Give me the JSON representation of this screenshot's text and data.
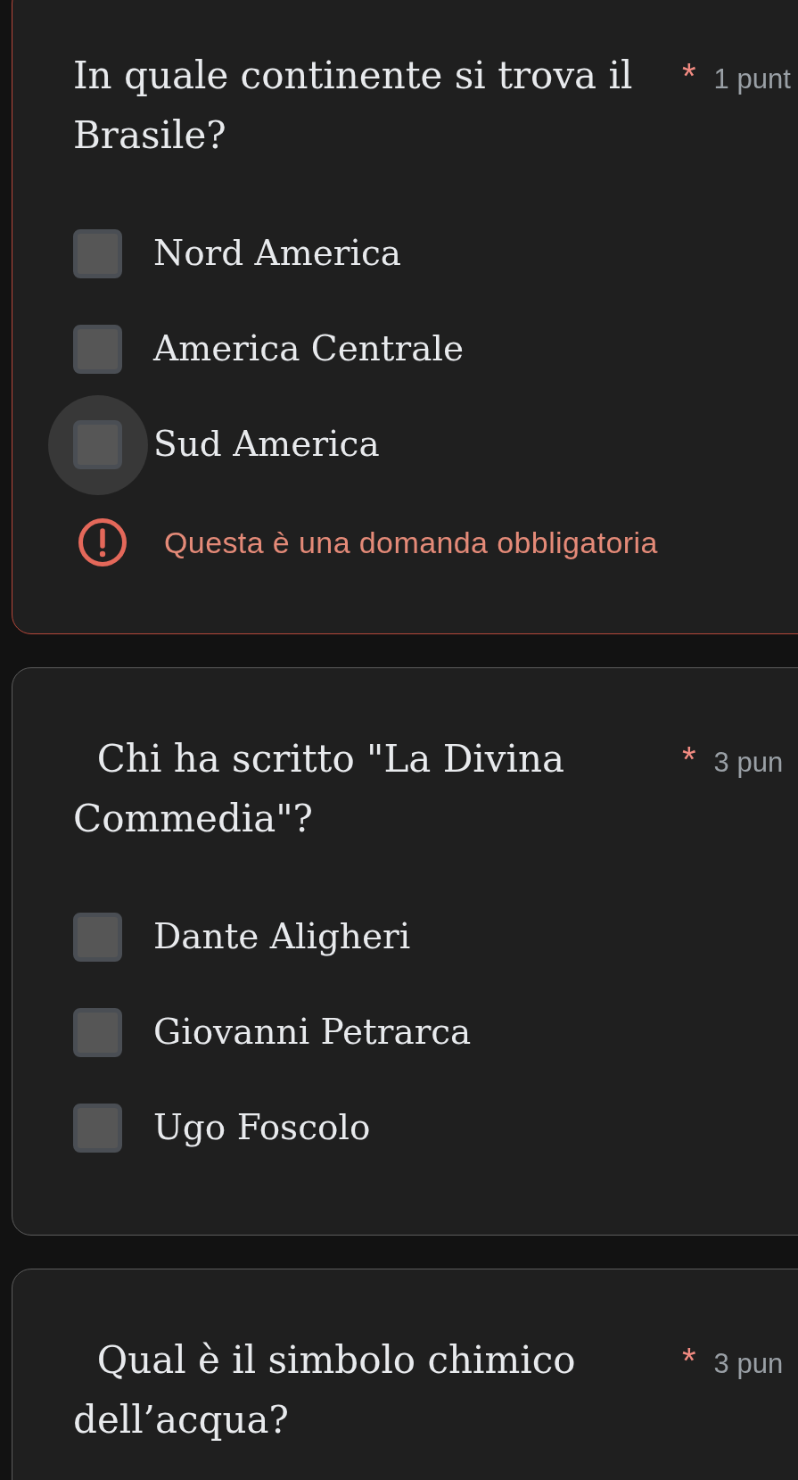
{
  "questions": [
    {
      "title": "In quale continente si trova il Brasile?",
      "required_mark": "*",
      "points": "1 punt",
      "options": [
        {
          "label": "Nord America",
          "checked": false,
          "focused": false
        },
        {
          "label": "America Centrale",
          "checked": false,
          "focused": false
        },
        {
          "label": "Sud America",
          "checked": false,
          "focused": true
        }
      ],
      "error": "Questa è una domanda obbligatoria"
    },
    {
      "title": "  Chi ha scritto \"La Divina Commedia\"?",
      "required_mark": "*",
      "points": "3 pun",
      "options": [
        {
          "label": "Dante Aligheri",
          "checked": false,
          "focused": false
        },
        {
          "label": "Giovanni Petrarca",
          "checked": false,
          "focused": false
        },
        {
          "label": "Ugo Foscolo",
          "checked": false,
          "focused": false
        }
      ]
    },
    {
      "title": "  Qual è il simbolo chimico dell’acqua?",
      "required_mark": "*",
      "points": "3 pun"
    }
  ]
}
